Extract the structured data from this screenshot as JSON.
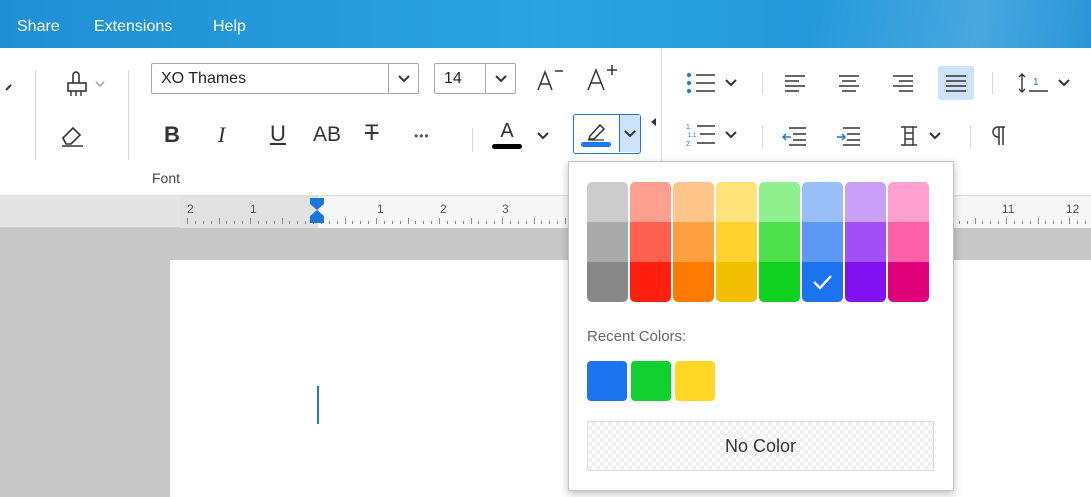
{
  "menu": {
    "items": [
      "Share",
      "Extensions",
      "Help"
    ]
  },
  "font_group": {
    "font_name": "XO Thames",
    "font_size": "14",
    "label": "Font",
    "bold": "B",
    "italic": "I",
    "underline": "U",
    "uppercase": "AB",
    "strikethrough": "T",
    "more": "•••",
    "text_color": "A",
    "text_color_value": "#000000",
    "highlight_color_value": "#1b78f0"
  },
  "ruler": {
    "numbers": [
      "2",
      "1",
      "1",
      "2",
      "3",
      "11",
      "12"
    ]
  },
  "highlight_popup": {
    "palette": [
      [
        "#cccccc",
        "#aaaaaa",
        "#888888"
      ],
      [
        "#ff9f8f",
        "#ff6050",
        "#ff2010"
      ],
      [
        "#ffc48a",
        "#ffa040",
        "#ff7a00"
      ],
      [
        "#ffe27a",
        "#ffd230",
        "#f3c000"
      ],
      [
        "#90f090",
        "#4ce04c",
        "#10d020"
      ],
      [
        "#98bff8",
        "#5c98f4",
        "#1b73f0"
      ],
      [
        "#caa0f8",
        "#a050f4",
        "#8010f0"
      ],
      [
        "#ffa0d0",
        "#ff60a8",
        "#e0007a"
      ]
    ],
    "selected": "#1b73f0",
    "recent_label": "Recent Colors:",
    "recent_colors": [
      "#1b73f0",
      "#12d030",
      "#ffd825"
    ],
    "no_color_label": "No Color"
  }
}
